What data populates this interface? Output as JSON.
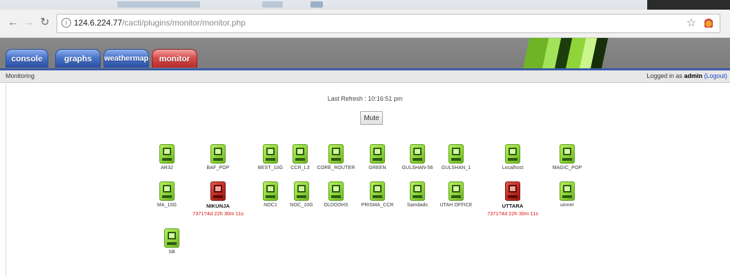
{
  "browser": {
    "url_host": "124.6.224.77",
    "url_path": "/cacti/plugins/monitor/monitor.php"
  },
  "tabs": [
    {
      "label": "console",
      "active": false
    },
    {
      "label": "graphs",
      "active": false
    },
    {
      "label": "weathermap",
      "active": false
    },
    {
      "label": "monitor",
      "active": true
    }
  ],
  "breadcrumb": "Monitoring",
  "login": {
    "prefix": "Logged in as",
    "user": "admin",
    "logout_label": "(Logout)"
  },
  "last_refresh": "Last Refresh : 10:16:51 pm",
  "mute_label": "Mute",
  "status_colors": {
    "up": "#8fd438",
    "down": "#c02d22",
    "down_text": "#e01010"
  },
  "devices": [
    {
      "name": "AR32",
      "status": "up"
    },
    {
      "name": "BAF_POP",
      "status": "up"
    },
    {
      "name": "BEST_10G",
      "status": "up"
    },
    {
      "name": "CCR_L3",
      "status": "up"
    },
    {
      "name": "CORE_ROUTER",
      "status": "up"
    },
    {
      "name": "GREEN",
      "status": "up"
    },
    {
      "name": "GULSHAN-56",
      "status": "up"
    },
    {
      "name": "GULSHAN_1",
      "status": "up"
    },
    {
      "name": "Localhost",
      "status": "up"
    },
    {
      "name": "MAGIC_POP",
      "status": "up"
    },
    {
      "name": "MA_10G",
      "status": "up"
    },
    {
      "name": "NIKUNJA",
      "status": "down",
      "down_time": "7371?4d 22h 30m 11s"
    },
    {
      "name": "NOC1",
      "status": "up"
    },
    {
      "name": "NOC_10G",
      "status": "up"
    },
    {
      "name": "OLDDOHS",
      "status": "up"
    },
    {
      "name": "PRISMA_CCR",
      "status": "up"
    },
    {
      "name": "Samdads",
      "status": "up"
    },
    {
      "name": "UTAH OFFICE",
      "status": "up"
    },
    {
      "name": "UTTARA",
      "status": "down",
      "down_time": "7371?4d 22h 30m 11s"
    },
    {
      "name": "uinner",
      "status": "up"
    },
    {
      "name": "SB",
      "status": "up"
    }
  ]
}
